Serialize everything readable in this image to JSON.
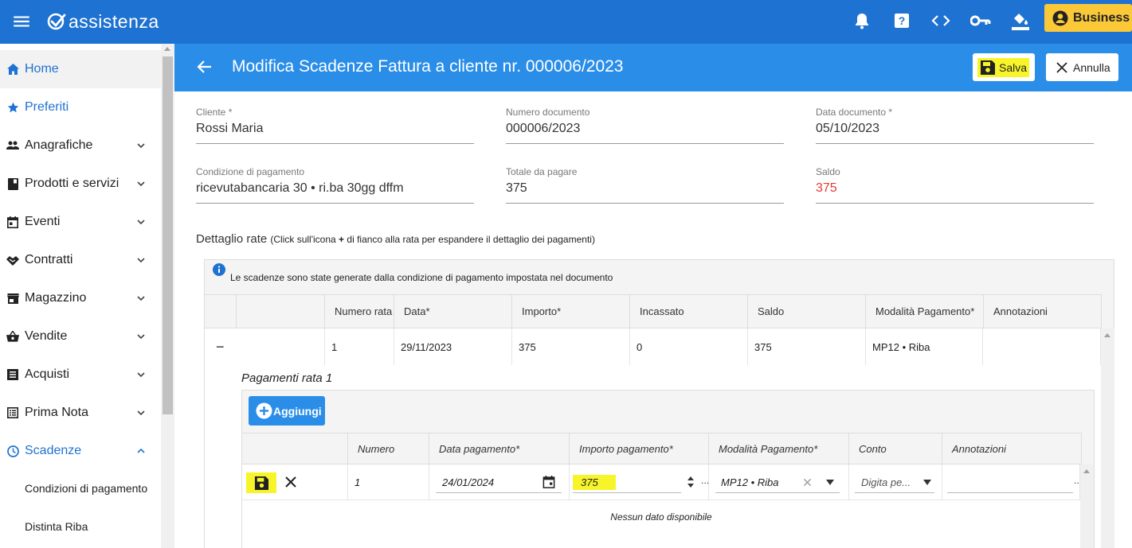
{
  "topbar": {
    "logo_text": "assistenza",
    "business_label": "Business",
    "icons": [
      "menu-icon",
      "bell-icon",
      "help-icon",
      "code-icon",
      "key-icon",
      "paint-bucket-icon",
      "account-circle-icon"
    ]
  },
  "sidebar": {
    "items": [
      {
        "label": "Home",
        "icon": "home-icon"
      },
      {
        "label": "Preferiti",
        "icon": "star-icon"
      },
      {
        "label": "Anagrafiche",
        "icon": "people-icon"
      },
      {
        "label": "Prodotti e servizi",
        "icon": "book-icon"
      },
      {
        "label": "Eventi",
        "icon": "calendar-icon"
      },
      {
        "label": "Contratti",
        "icon": "handshake-icon"
      },
      {
        "label": "Magazzino",
        "icon": "store-icon"
      },
      {
        "label": "Vendite",
        "icon": "basket-icon"
      },
      {
        "label": "Acquisti",
        "icon": "receipt-icon"
      },
      {
        "label": "Prima Nota",
        "icon": "ledger-icon"
      },
      {
        "label": "Scadenze",
        "icon": "clock-icon"
      }
    ],
    "subitems": [
      "Condizioni di pagamento",
      "Distinta Riba"
    ]
  },
  "header": {
    "title": "Modifica Scadenze Fattura a cliente nr. 000006/2023",
    "save_label": "Salva",
    "cancel_label": "Annulla"
  },
  "form": {
    "cliente_label": "Cliente *",
    "cliente_value": "Rossi Maria",
    "numero_label": "Numero documento",
    "numero_value": "000006/2023",
    "data_label": "Data documento *",
    "data_value": "05/10/2023",
    "condizione_label": "Condizione di pagamento",
    "condizione_value": "ricevutabancaria 30 • ri.ba 30gg dffm",
    "totale_label": "Totale da pagare",
    "totale_value": "375",
    "saldo_label": "Saldo",
    "saldo_value": "375",
    "saldo_color": "#e53935"
  },
  "rate": {
    "section_title": "Dettaglio rate",
    "hint_before": "(Click sull'icona",
    "hint_plus": "+",
    "hint_after": "di fianco alla rata per espandere il dettaglio dei pagamenti)",
    "info_text": "Le scadenze sono state generate dalla condizione di pagamento impostata nel documento",
    "columns": [
      "Numero rata",
      "Data*",
      "Importo*",
      "Incassato",
      "Saldo",
      "Modalità Pagamento*",
      "Annotazioni"
    ],
    "row": {
      "collapse": "−",
      "numero": "1",
      "data": "29/11/2023",
      "importo": "375",
      "incassato": "0",
      "saldo": "375",
      "modalita": "MP12 • Riba",
      "annotazioni": ""
    }
  },
  "pagamenti": {
    "title": "Pagamenti rata 1",
    "add_label": "Aggiungi",
    "columns": [
      "Numero",
      "Data pagamento*",
      "Importo pagamento*",
      "Modalità Pagamento*",
      "Conto",
      "Annotazioni"
    ],
    "row": {
      "numero": "1",
      "data": "24/01/2024",
      "importo": "375",
      "modalita": "MP12 • Riba",
      "conto_placeholder": "Digita pe...",
      "annotazioni": ""
    },
    "empty_text": "Nessun dato disponibile"
  },
  "colors": {
    "topbar": "#1e72d1",
    "header": "#2a8ee8",
    "business": "#fbc837",
    "highlight": "#f7f52a"
  }
}
